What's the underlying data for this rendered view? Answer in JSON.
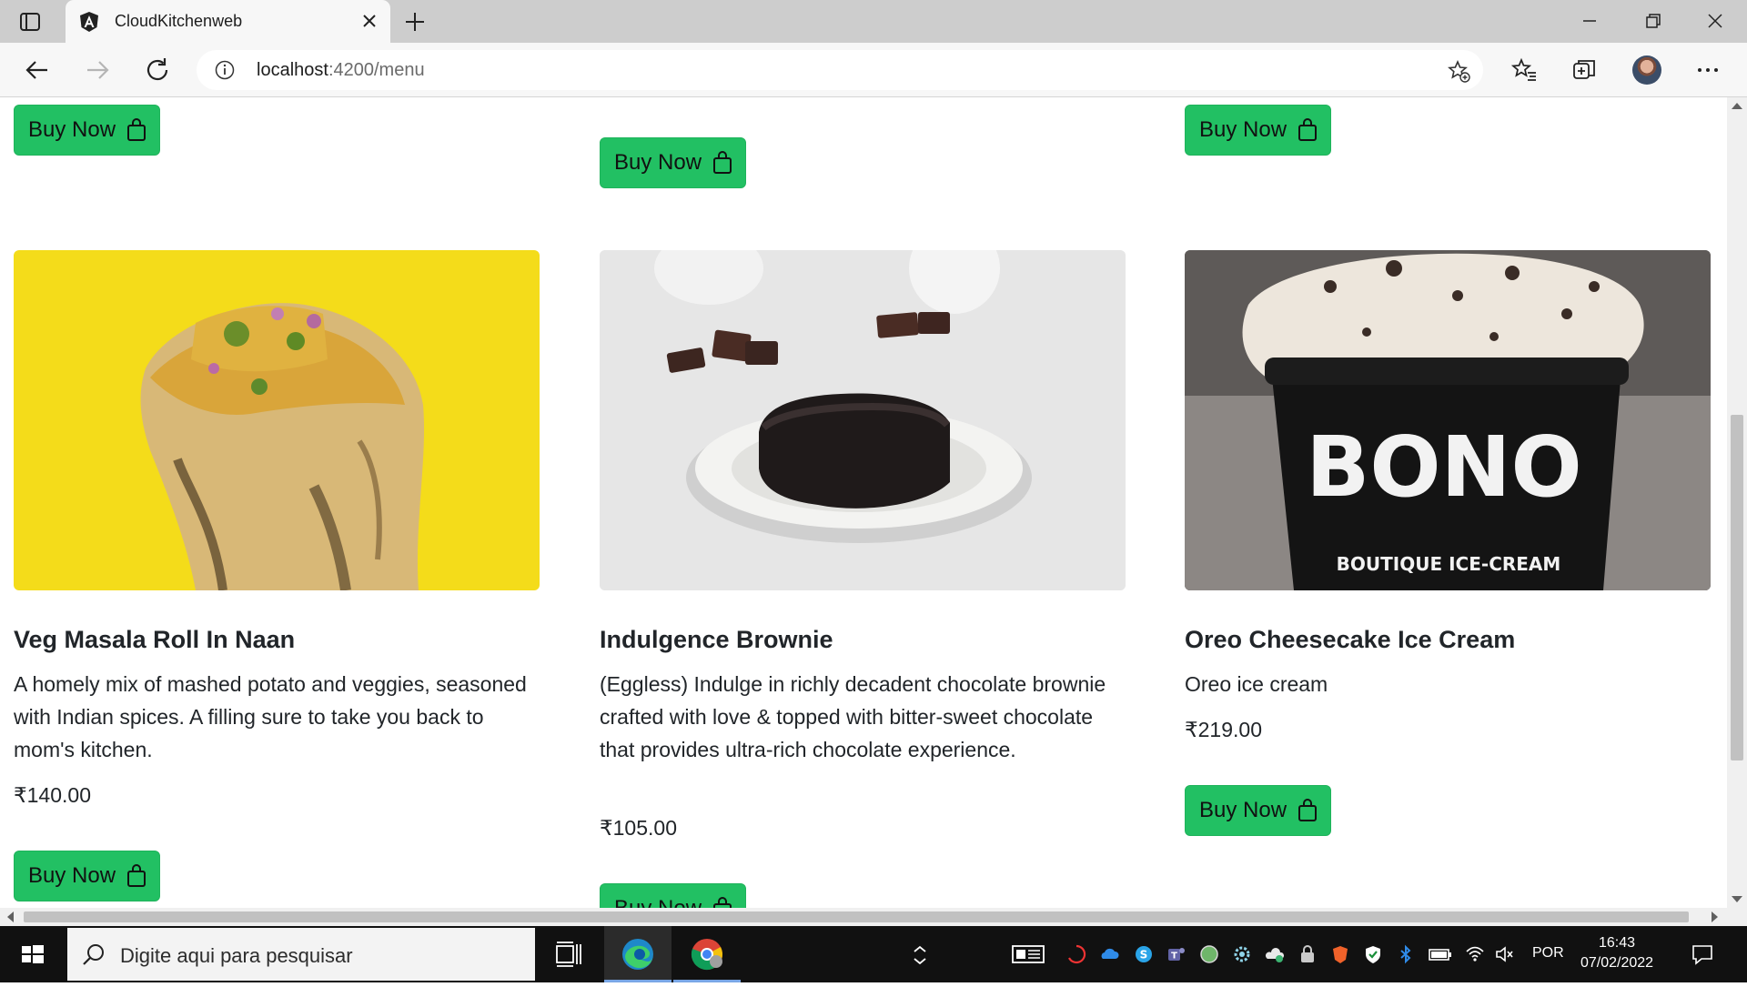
{
  "browser": {
    "tab_title": "CloudKitchenweb",
    "url_host": "localhost",
    "url_path": ":4200/menu"
  },
  "buttons": {
    "buy_now": "Buy Now"
  },
  "menu_items": [
    {
      "name": "Veg Masala Roll In Naan",
      "description": "A homely mix of mashed potato and veggies, seasoned with Indian spices. A filling sure to take you back to mom's kitchen.",
      "price": "₹140.00",
      "image": "veg-masala-roll-photo"
    },
    {
      "name": "Indulgence Brownie",
      "description": "(Eggless) Indulge in richly decadent chocolate brownie crafted with love & topped with bitter-sweet chocolate that provides ultra-rich chocolate experience.",
      "price": "₹105.00",
      "image": "brownie-photo"
    },
    {
      "name": "Oreo Cheesecake Ice Cream",
      "description": "Oreo ice cream",
      "price": "₹219.00",
      "image": "oreo-ice-cream-photo",
      "logo_text": "BONO",
      "logo_subtext": "BOUTIQUE ICE-CREAM"
    }
  ],
  "colors": {
    "buy_button": "#22c063",
    "taskbar": "#111111"
  },
  "taskbar": {
    "search_placeholder": "Digite aqui para pesquisar",
    "language": "POR",
    "time": "16:43",
    "date": "07/02/2022"
  }
}
